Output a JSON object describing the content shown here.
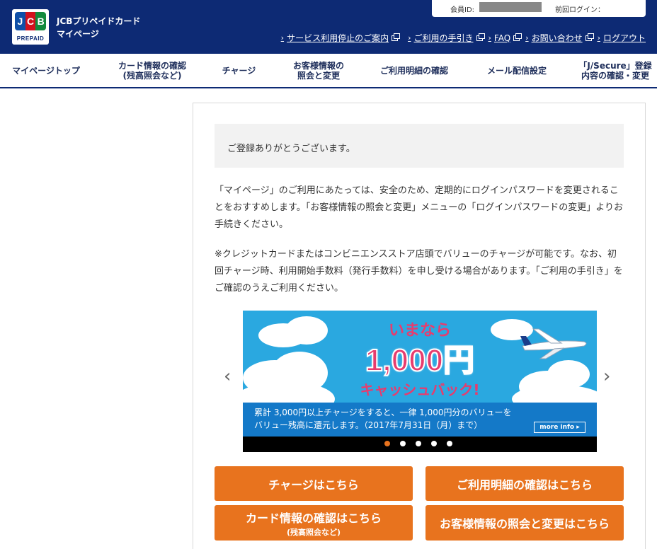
{
  "header": {
    "logo_brand": "JCB",
    "logo_sub": "PREPAID",
    "brand_line1": "JCBプリペイドカード",
    "brand_line2": "マイページ",
    "member_id_label": "会員ID:",
    "last_login_label": "前回ログイン：",
    "links": [
      {
        "label": "サービス利用停止のご案内",
        "external": true
      },
      {
        "label": "ご利用の手引き",
        "external": true
      },
      {
        "label": "FAQ",
        "external": true
      },
      {
        "label": "お問い合わせ",
        "external": true
      },
      {
        "label": "ログアウト",
        "external": false
      }
    ]
  },
  "nav": {
    "items": [
      {
        "line1": "マイページトップ",
        "line2": ""
      },
      {
        "line1": "カード情報の確認",
        "line2": "(残高照会など)"
      },
      {
        "line1": "チャージ",
        "line2": ""
      },
      {
        "line1": "お客様情報の",
        "line2": "照会と変更"
      },
      {
        "line1": "ご利用明細の確認",
        "line2": ""
      },
      {
        "line1": "メール配信設定",
        "line2": ""
      },
      {
        "line1": "「J/Secure」登録",
        "line2": "内容の確認・変更"
      }
    ]
  },
  "main": {
    "notice": "ご登録ありがとうございます。",
    "para1": "「マイページ」のご利用にあたっては、安全のため、定期的にログインパスワードを変更されることをおすすめします。「お客様情報の照会と変更」メニューの「ログインパスワードの変更」よりお手続きください。",
    "para2": "※クレジットカードまたはコンビニエンスストア店頭でバリューのチャージが可能です。なお、初回チャージ時、利用開始手数料（発行手数料）を申し受ける場合があります。「ご利用の手引き」をご確認のうえご利用ください。"
  },
  "banner": {
    "headline1": "いまなら",
    "headline2": "1,000円",
    "headline3": "キャッシュバック!",
    "text_line1": "累計 3,000円以上チャージをすると、一律 1,000円分のバリューを",
    "text_line2": "バリュー残高に還元します。（2017年7月31日（月）まで）",
    "more_info": "more info ▸",
    "arrow_left": "‹",
    "arrow_right": "›",
    "slide_count": 5,
    "active_slide": 1
  },
  "buttons": {
    "charge": "チャージはこちら",
    "history": "ご利用明細の確認はこちら",
    "card_info": "カード情報の確認はこちら",
    "card_info_sub": "(残高照会など)",
    "customer_info": "お客様情報の照会と変更はこちら"
  },
  "colors": {
    "header_bg": "#0d2a74",
    "accent_orange": "#e8731e",
    "banner_sky": "#2aa8e0",
    "banner_pink": "#e73c6e"
  }
}
